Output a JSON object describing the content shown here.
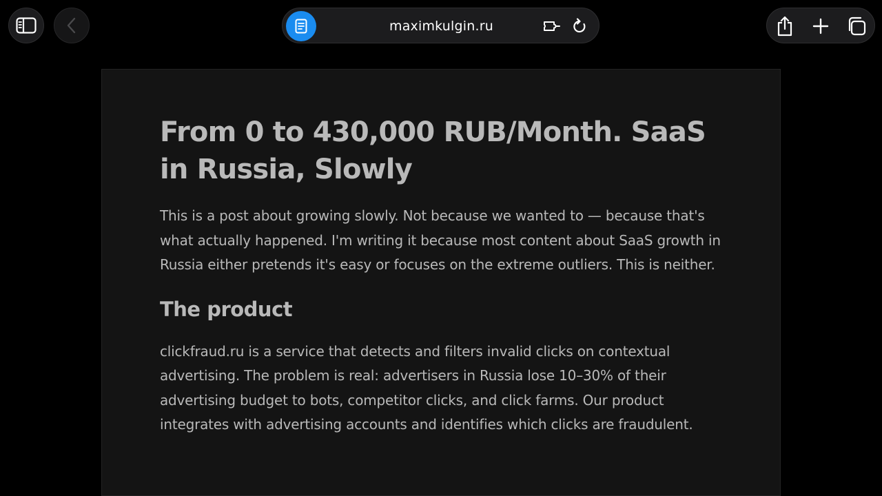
{
  "browser": {
    "url": "maximkulgin.ru",
    "accent_color": "#1a8cf0",
    "icons": {
      "sidebar": "sidebar-icon",
      "back": "chevron-left-icon",
      "reader": "reader-mode-icon",
      "extension": "extension-icon",
      "reload": "reload-icon",
      "share": "share-icon",
      "new_tab": "plus-icon",
      "tabs": "tab-overview-icon"
    }
  },
  "article": {
    "title": "From 0 to 430,000 RUB/Month. SaaS in Russia, Slowly",
    "intro": "This is a post about growing slowly. Not because we wanted to — because that's what actually happened. I'm writing it because most content about SaaS growth in Russia either pretends it's easy or focuses on the extreme outliers. This is neither.",
    "section_heading": "The product",
    "section_paragraph": "clickfraud.ru is a service that detects and filters invalid clicks on contextual advertising. The problem is real: advertisers in Russia lose 10–30% of their advertising budget to bots, competitor clicks, and click farms. Our product integrates with advertising accounts and identifies which clicks are fraudulent."
  }
}
